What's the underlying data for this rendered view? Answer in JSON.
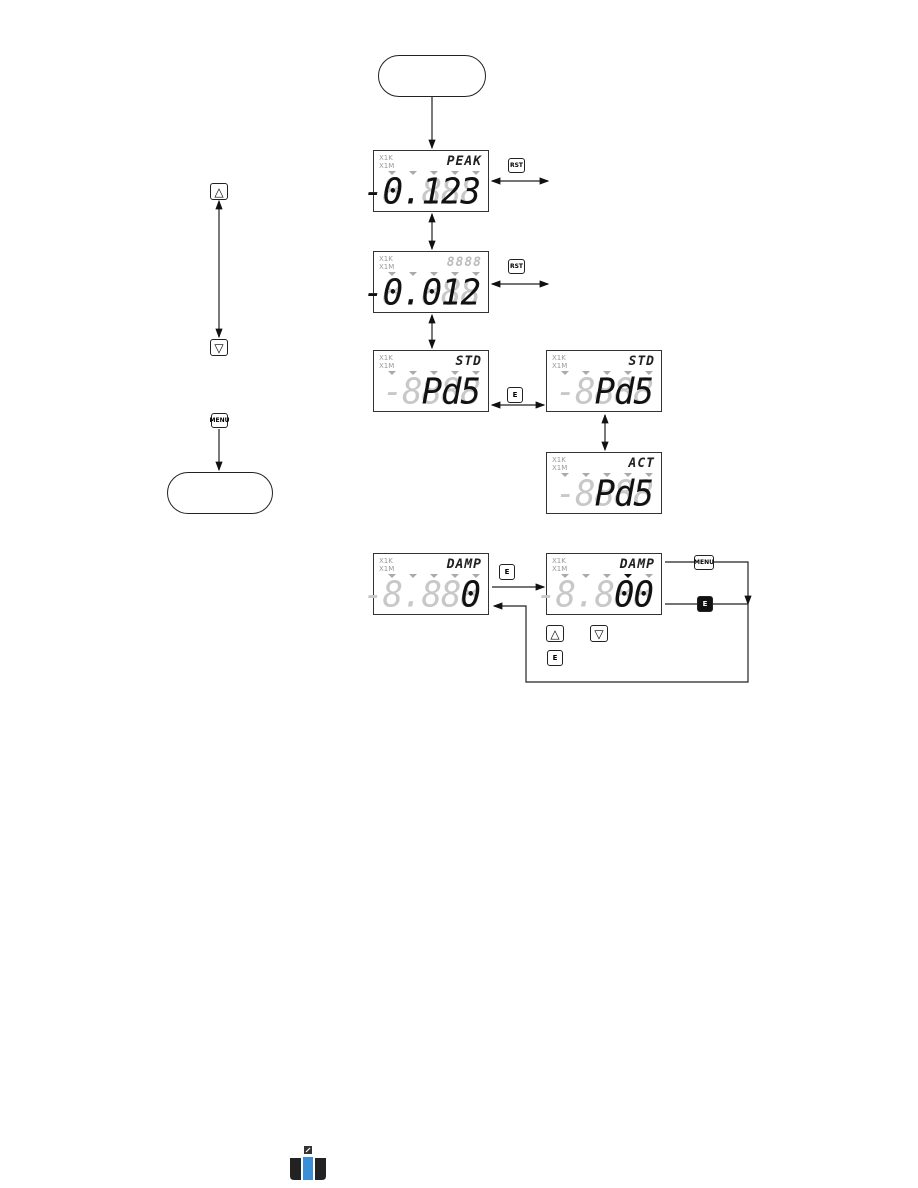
{
  "indicator_labels": [
    "X1K",
    "X1M"
  ],
  "displays": [
    {
      "id": "peak",
      "label": "PEAK",
      "label_active": true,
      "ghost": "-8.888",
      "value": "-0.123",
      "active_tri": -1
    },
    {
      "id": "value",
      "label": "8888",
      "label_active": false,
      "ghost": "-8.888",
      "value": "-0.012",
      "active_tri": -1
    },
    {
      "id": "std-left",
      "label": "STD",
      "label_active": true,
      "ghost": "-8888",
      "value": " Pd5",
      "active_tri": -1
    },
    {
      "id": "std-right",
      "label": "STD",
      "label_active": true,
      "ghost": "-8888",
      "value": " Pd5",
      "active_tri": -1
    },
    {
      "id": "act",
      "label": "ACT",
      "label_active": true,
      "ghost": "-8888",
      "value": " Pd5",
      "active_tri": -1
    },
    {
      "id": "damp-left",
      "label": "DAMP",
      "label_active": true,
      "ghost": "-8.888",
      "value": "    0",
      "active_tri": -1
    },
    {
      "id": "damp-right",
      "label": "DAMP",
      "label_active": true,
      "ghost": "-8.888",
      "value": "   00",
      "active_tri": 3
    }
  ],
  "keys": {
    "up": "△",
    "down": "▽",
    "menu": "MENU",
    "rst": "RST",
    "enter": "E"
  },
  "colors": {
    "logo_blue": "#3a8fd6",
    "logo_dark": "#222222"
  }
}
